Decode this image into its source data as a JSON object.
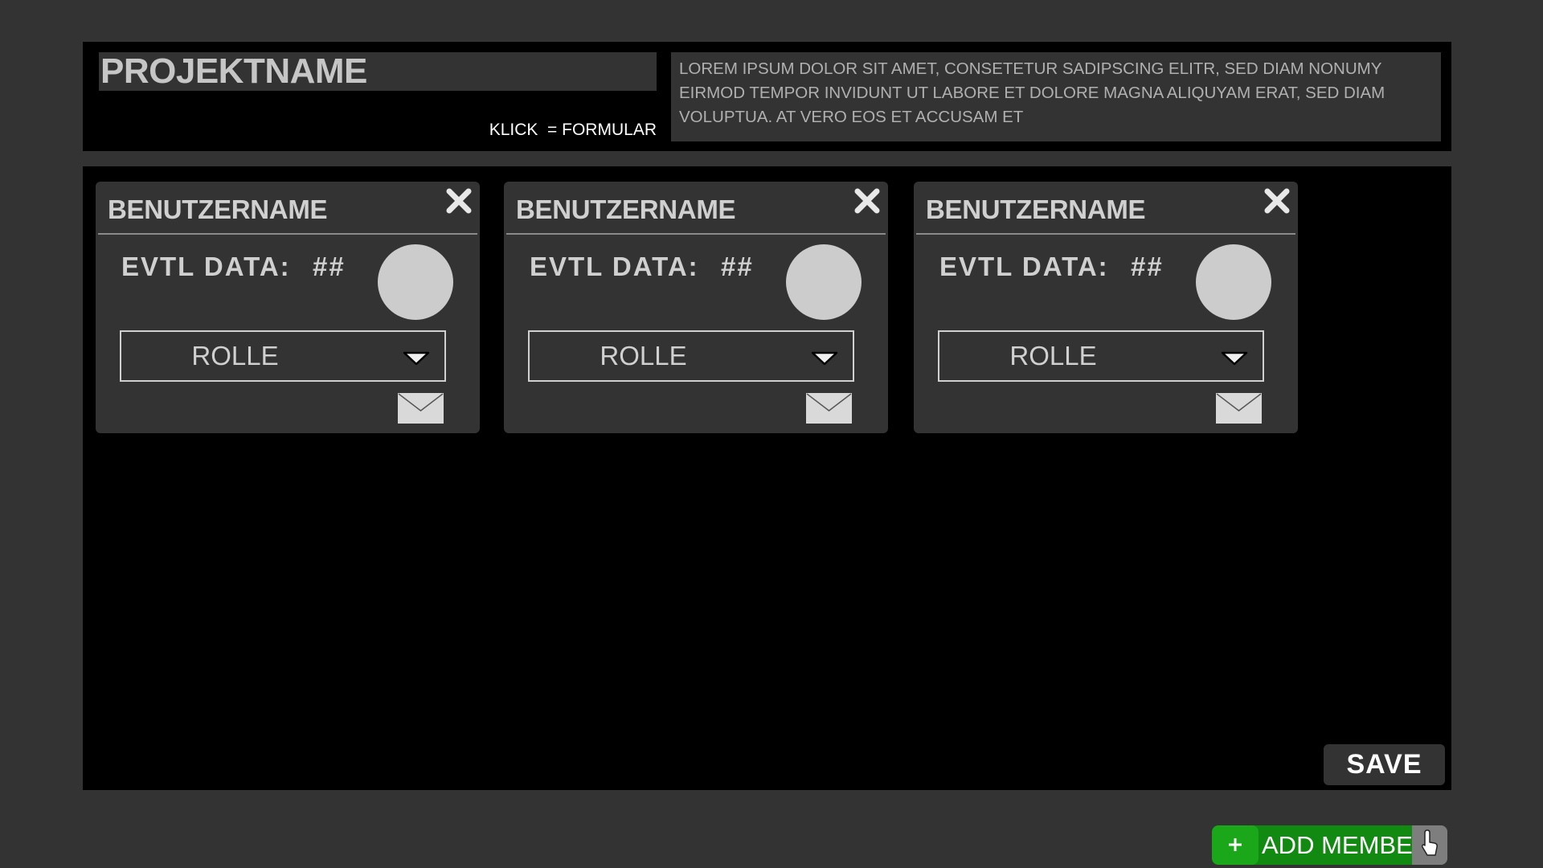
{
  "header": {
    "project_name": "PROJEKTNAME",
    "klick_hint": "KLICK  = FORMULAR",
    "description": "LOREM IPSUM DOLOR SIT AMET, CONSETETUR SADIPSCING ELITR, SED DIAM NONUMY EIRMOD TEMPOR INVIDUNT UT LABORE ET DOLORE MAGNA ALIQUYAM ERAT, SED DIAM VOLUPTUA. AT VERO EOS ET ACCUSAM ET"
  },
  "members": [
    {
      "username": "BENUTZERNAME",
      "data_label": "EVTL DATA:",
      "data_value": "##",
      "role": "ROLLE",
      "icons": {
        "close": "close-icon",
        "mail": "mail-icon",
        "dropdown": "chevron-down-icon"
      }
    },
    {
      "username": "BENUTZERNAME",
      "data_label": "EVTL DATA:",
      "data_value": "##",
      "role": "ROLLE",
      "icons": {
        "close": "close-icon",
        "mail": "mail-icon",
        "dropdown": "chevron-down-icon"
      }
    },
    {
      "username": "BENUTZERNAME",
      "data_label": "EVTL DATA:",
      "data_value": "##",
      "role": "ROLLE",
      "icons": {
        "close": "close-icon",
        "mail": "mail-icon",
        "dropdown": "chevron-down-icon"
      }
    }
  ],
  "actions": {
    "save_label": "SAVE",
    "add_member_label": "ADD MEMBER"
  },
  "colors": {
    "background": "#333333",
    "panel": "#000000",
    "accent_green": "#1aa81a",
    "avatar": "#cccccc"
  }
}
